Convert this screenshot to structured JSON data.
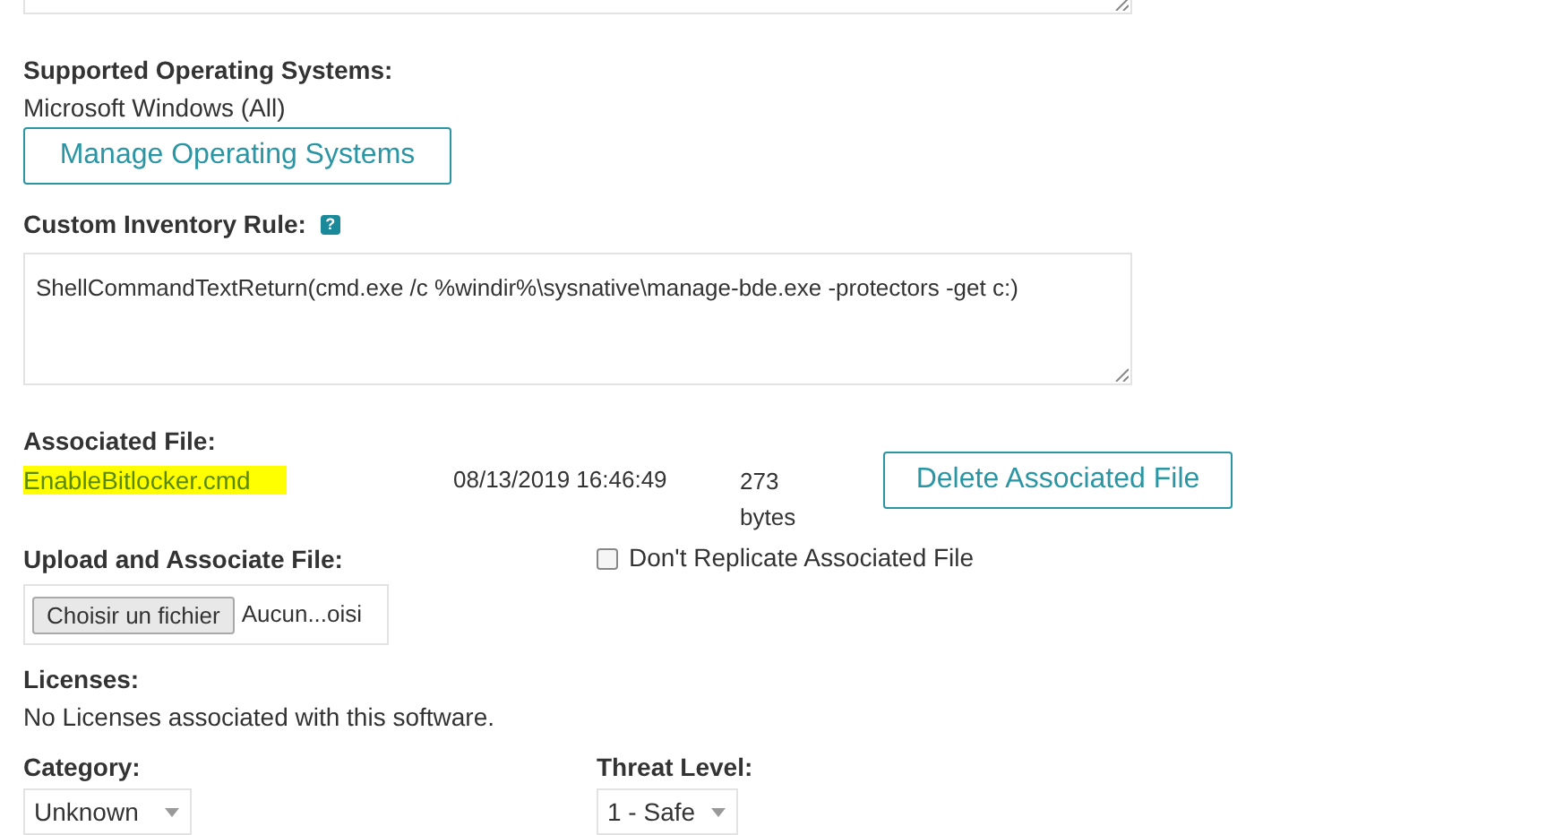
{
  "supported_os": {
    "label": "Supported Operating Systems:",
    "value": "Microsoft Windows (All)",
    "button": "Manage Operating Systems"
  },
  "custom_inventory_rule": {
    "label": "Custom Inventory Rule:",
    "help": "?",
    "value": "ShellCommandTextReturn(cmd.exe /c %windir%\\sysnative\\manage-bde.exe -protectors -get c:)"
  },
  "associated_file": {
    "label": "Associated File:",
    "file_name": "EnableBitlocker.cmd",
    "highlighted": true,
    "date": "08/13/2019 16:46:49",
    "size": "273",
    "size_unit": "bytes",
    "button": "Delete Associated File"
  },
  "upload": {
    "label": "Upload and Associate File:",
    "choose_button": "Choisir un fichier",
    "file_status": "Aucun...oisi"
  },
  "dont_replicate": {
    "label": "Don't Replicate Associated File",
    "checked": false
  },
  "licenses": {
    "label": "Licenses:",
    "value": "No Licenses associated with this software."
  },
  "category": {
    "label": "Category:",
    "value": "Unknown"
  },
  "threat_level": {
    "label": "Threat Level:",
    "value": "1 - Safe"
  }
}
